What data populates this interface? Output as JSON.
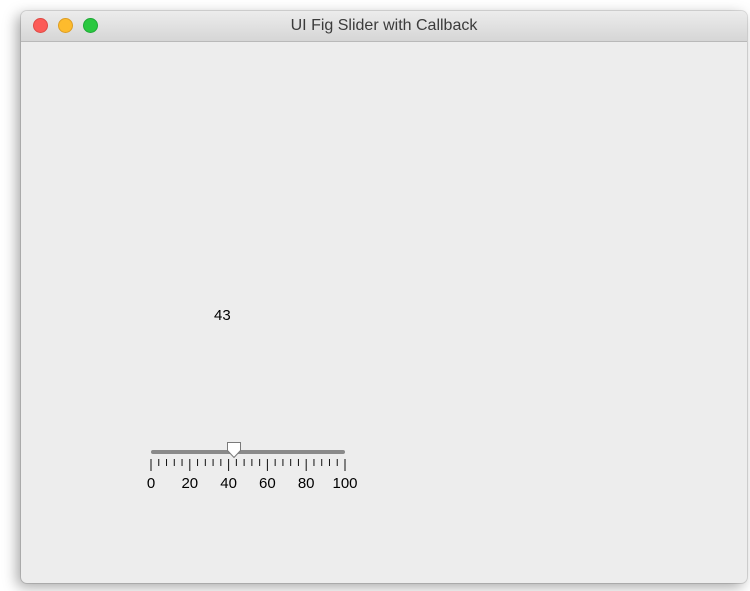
{
  "window": {
    "title": "UI Fig Slider with Callback",
    "traffic_lights": {
      "close_color": "#fc5b57",
      "minimize_color": "#fdbb2d",
      "maximize_color": "#2ac840"
    }
  },
  "value_label": {
    "text": "43"
  },
  "slider": {
    "value": 43,
    "min": 0,
    "max": 100,
    "major_ticks": [
      0,
      20,
      40,
      60,
      80,
      100
    ],
    "minor_step": 4,
    "tick_labels": [
      "0",
      "20",
      "40",
      "60",
      "80",
      "100"
    ]
  }
}
